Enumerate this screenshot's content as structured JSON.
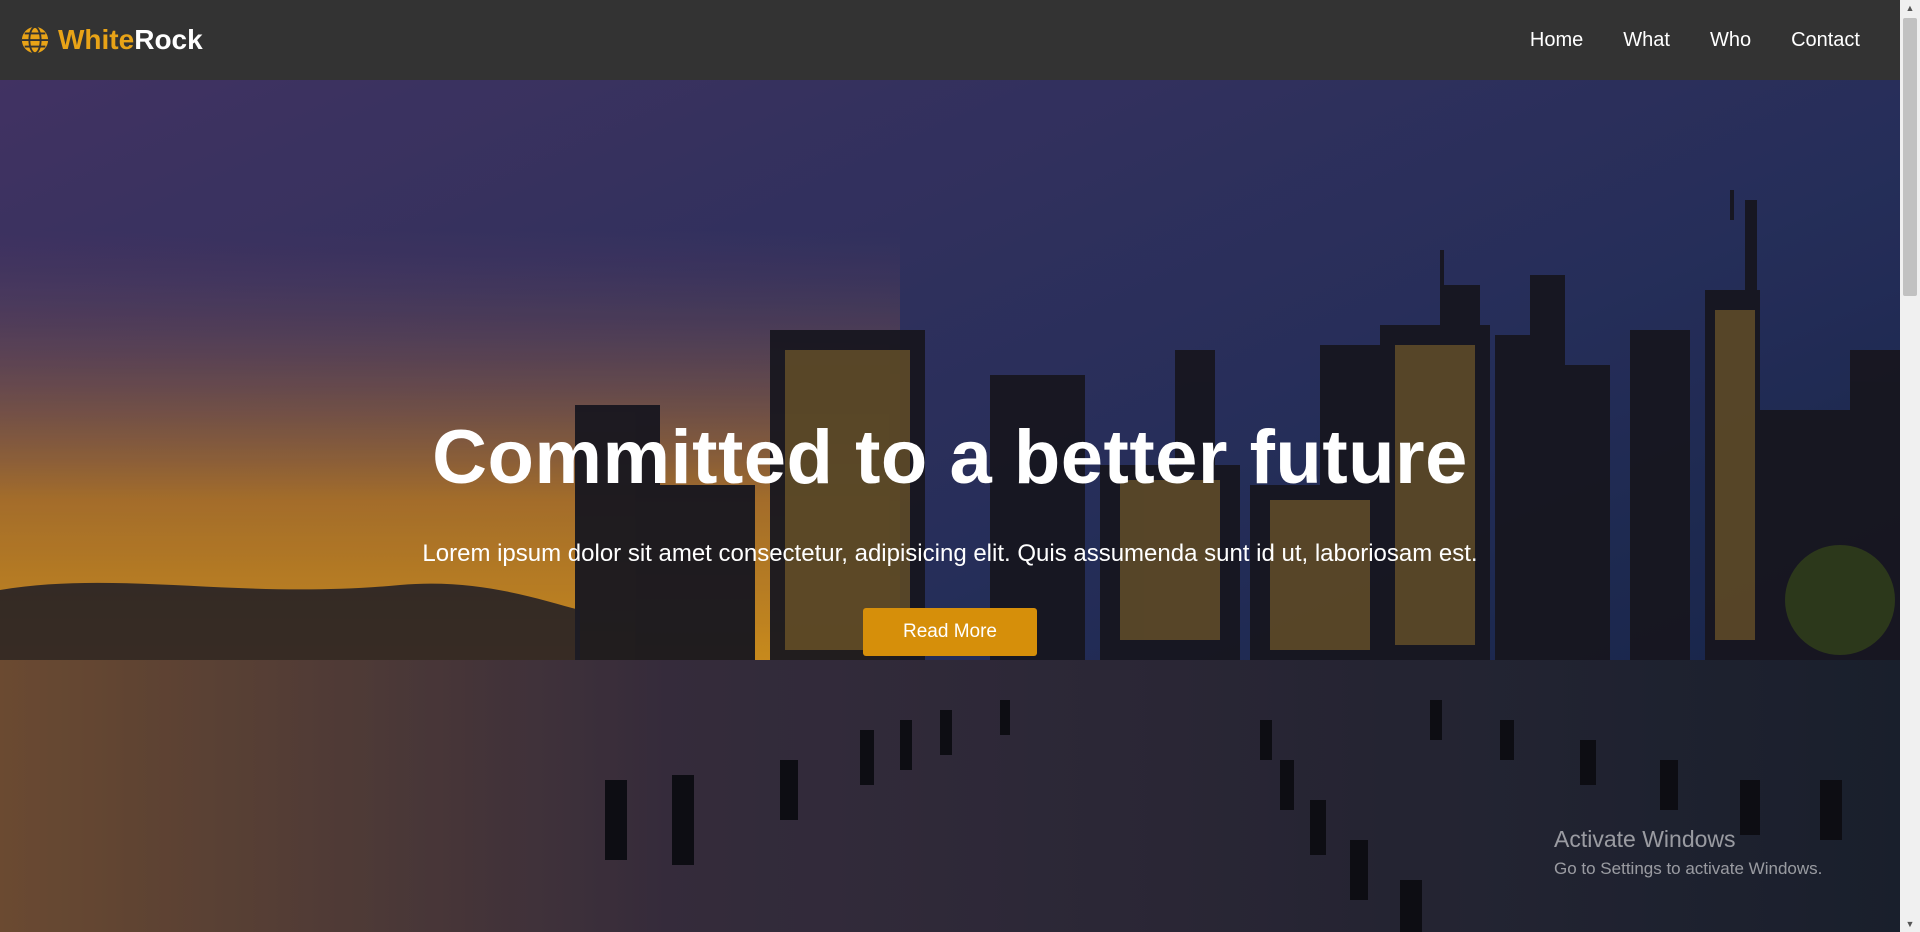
{
  "navbar": {
    "brand_white": "White",
    "brand_rock": "Rock",
    "links": [
      "Home",
      "What",
      "Who",
      "Contact"
    ]
  },
  "hero": {
    "title": "Committed to a better future",
    "subtitle": "Lorem ipsum dolor sit amet consectetur, adipisicing elit. Quis assumenda sunt id ut, laboriosam est.",
    "button_label": "Read More"
  },
  "watermark": {
    "line1": "Activate Windows",
    "line2": "Go to Settings to activate Windows."
  },
  "colors": {
    "accent": "#d68f0a",
    "navbar_bg": "#333333"
  },
  "icons": {
    "brand": "globe-icon"
  }
}
